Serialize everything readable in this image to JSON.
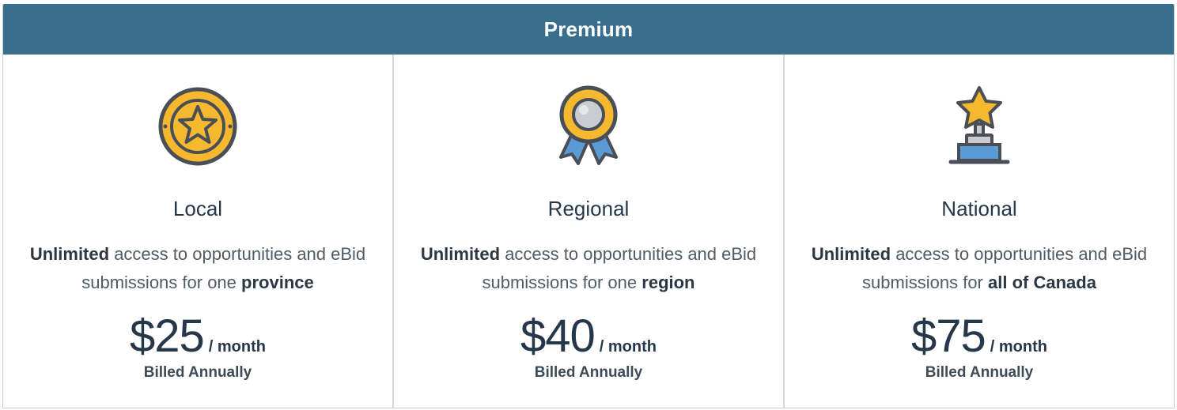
{
  "header": {
    "title": "Premium"
  },
  "plans": [
    {
      "name": "Local",
      "icon": "star-coin-icon",
      "desc_strong_1": "Unlimited",
      "desc_mid": "access to opportunities and eBid submissions for one",
      "desc_strong_2": "province",
      "price": "$25",
      "per": "/ month",
      "billing": "Billed Annually"
    },
    {
      "name": "Regional",
      "icon": "ribbon-medal-icon",
      "desc_strong_1": "Unlimited",
      "desc_mid": "access to opportunities and eBid submissions for one",
      "desc_strong_2": "region",
      "price": "$40",
      "per": "/ month",
      "billing": "Billed Annually"
    },
    {
      "name": "National",
      "icon": "trophy-icon",
      "desc_strong_1": "Unlimited",
      "desc_mid": "access to opportunities and eBid submissions for",
      "desc_strong_2": "all of Canada",
      "price": "$75",
      "per": "/ month",
      "billing": "Billed Annually"
    }
  ],
  "colors": {
    "header_bg": "#396e8c",
    "gold": "#f6b82e",
    "outline": "#4a4f57",
    "ribbon_blue": "#5b9bd5"
  }
}
